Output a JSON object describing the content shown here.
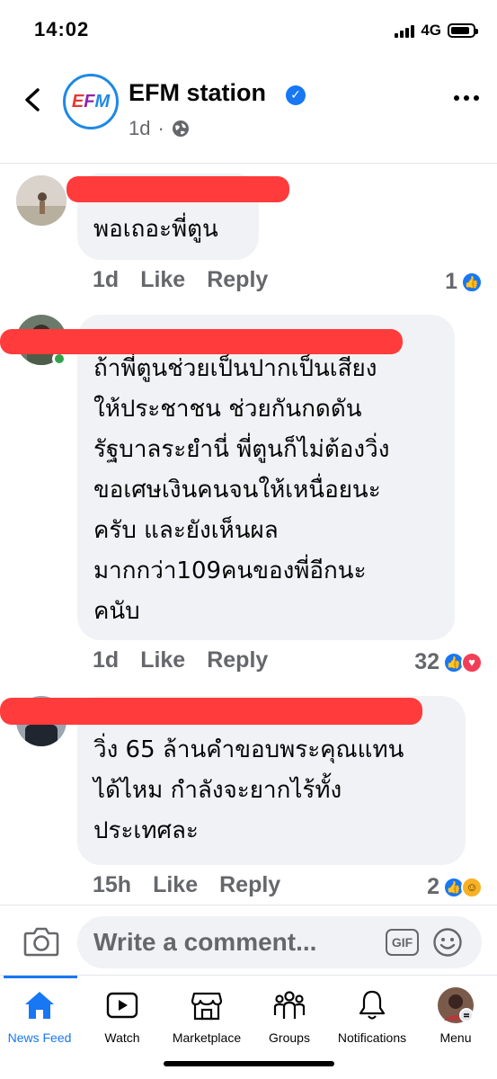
{
  "status": {
    "time": "14:02",
    "network": "4G"
  },
  "post": {
    "page_name": "EFM station",
    "logo_text": "EFM",
    "age": "1d",
    "separator": "·"
  },
  "comments": [
    {
      "text": "พอเถอะพี่ตูน",
      "time": "1d",
      "like": "Like",
      "reply": "Reply",
      "reaction_count": "1",
      "reactions": [
        "like"
      ]
    },
    {
      "text": "ถ้าพี่ตูนช่วยเป็นปากเป็นเสียง\nให้ประชาชน ช่วยกันกดดัน\nรัฐบาลระยำนี่ พี่ตูนก็ไม่ต้องวิ่ง\nขอเศษเงินคนจนให้เหนื่อยนะ\nครับ และยังเห็นผล\nมากกว่า109คนของพี่อีกนะ\nคนับ",
      "time": "1d",
      "like": "Like",
      "reply": "Reply",
      "reaction_count": "32",
      "reactions": [
        "like",
        "love"
      ]
    },
    {
      "text": "วิ่ง 65 ล้านคำขอบพระคุณแทน\nได้ไหม กำลังจะยากไร้ทั้ง\nประเทศละ",
      "time": "15h",
      "like": "Like",
      "reply": "Reply",
      "reaction_count": "2",
      "reactions": [
        "like",
        "haha"
      ]
    }
  ],
  "composer": {
    "placeholder": "Write a comment...",
    "gif_label": "GIF"
  },
  "tabs": [
    {
      "label": "News Feed",
      "icon": "home-icon",
      "active": true
    },
    {
      "label": "Watch",
      "icon": "watch-icon"
    },
    {
      "label": "Marketplace",
      "icon": "marketplace-icon"
    },
    {
      "label": "Groups",
      "icon": "groups-icon"
    },
    {
      "label": "Notifications",
      "icon": "bell-icon"
    },
    {
      "label": "Menu",
      "icon": "profile-avatar"
    }
  ],
  "colors": {
    "accent": "#1877f2",
    "redaction": "#ff3b3b",
    "bubble": "#f0f2f5",
    "muted": "#65676b"
  }
}
